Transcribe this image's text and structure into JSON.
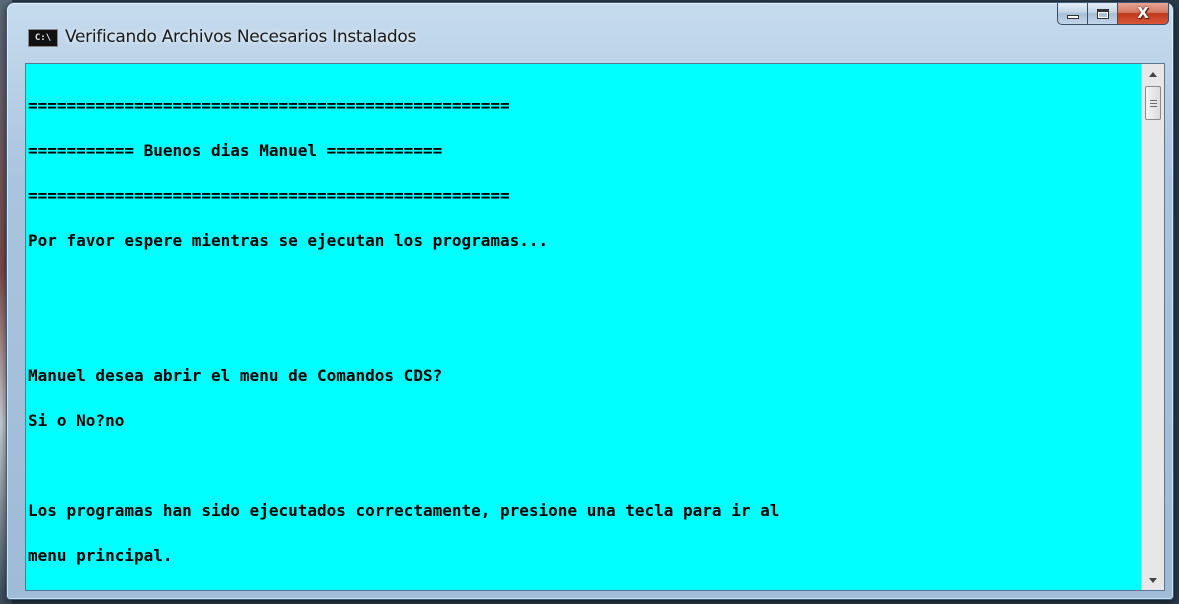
{
  "window": {
    "title": "Verificando Archivos Necesarios Instalados",
    "icon_label": "C:\\",
    "icon_name": "console-window-icon",
    "buttons": {
      "minimize_icon": "minimize-icon",
      "maximize_icon": "maximize-icon",
      "close_label": "X"
    }
  },
  "console": {
    "background_color": "#00ffff",
    "text_color": "#000000",
    "lines": [
      "==================================================",
      "=========== Buenos dias Manuel ============",
      "==================================================",
      "Por favor espere mientras se ejecutan los programas...",
      "",
      "",
      "Manuel desea abrir el menu de Comandos CDS?",
      "Si o No?no",
      "",
      "Los programas han sido ejecutados correctamente, presione una tecla para ir al",
      "menu principal."
    ]
  },
  "scrollbar": {
    "up_icon": "scroll-up-arrow-icon",
    "down_icon": "scroll-down-arrow-icon"
  }
}
